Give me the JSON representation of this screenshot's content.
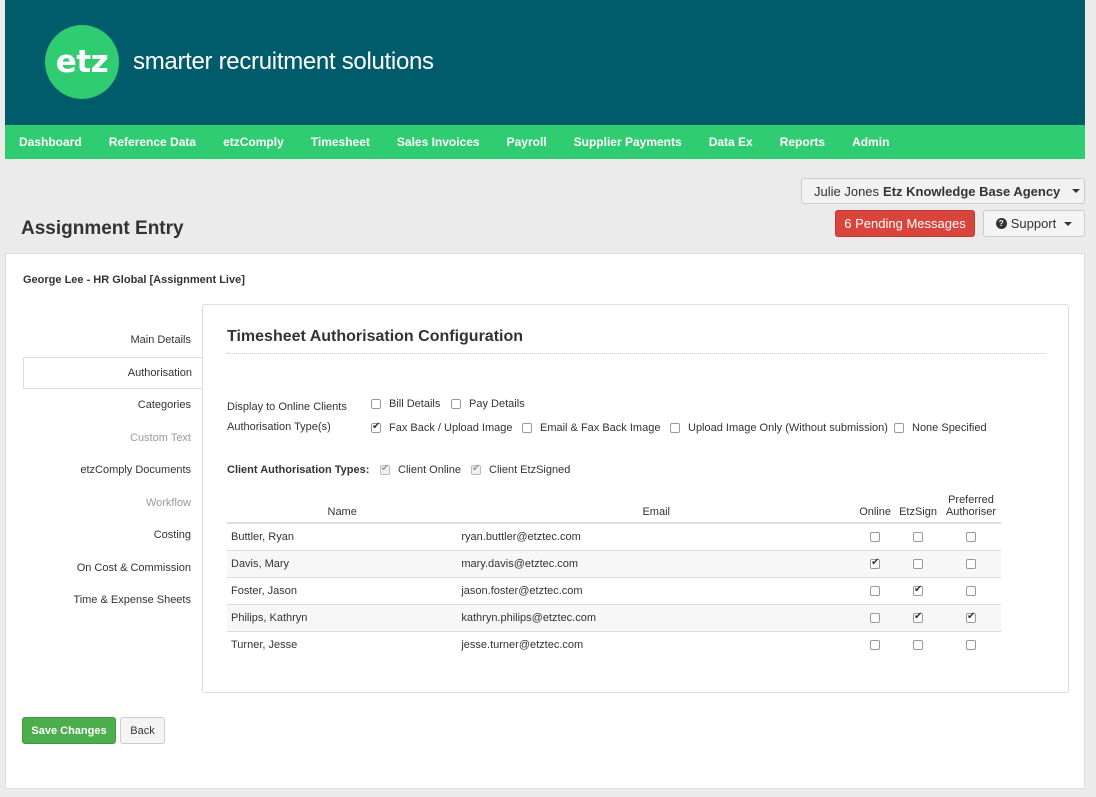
{
  "brand": {
    "logo_text": "etz",
    "tagline": "smarter recruitment solutions"
  },
  "nav": [
    "Dashboard",
    "Reference Data",
    "etzComply",
    "Timesheet",
    "Sales Invoices",
    "Payroll",
    "Supplier Payments",
    "Data Ex",
    "Reports",
    "Admin"
  ],
  "user": {
    "name": "Julie Jones",
    "agency": "Etz Knowledge Base Agency"
  },
  "pending_label": "6 Pending Messages",
  "support_label": "Support",
  "page_title": "Assignment Entry",
  "assignment_title": "George Lee - HR Global [Assignment Live]",
  "sidebar": [
    {
      "label": "Main Details",
      "state": "normal"
    },
    {
      "label": "Authorisation",
      "state": "active"
    },
    {
      "label": "Categories",
      "state": "normal"
    },
    {
      "label": "Custom Text",
      "state": "disabled"
    },
    {
      "label": "etzComply Documents",
      "state": "normal"
    },
    {
      "label": "Workflow",
      "state": "disabled"
    },
    {
      "label": "Costing",
      "state": "normal"
    },
    {
      "label": "On Cost & Commission",
      "state": "normal"
    },
    {
      "label": "Time & Expense Sheets",
      "state": "normal"
    }
  ],
  "section_title": "Timesheet Authorisation Configuration",
  "display_online": {
    "label": "Display to Online Clients",
    "options": [
      {
        "label": "Bill Details",
        "checked": false
      },
      {
        "label": "Pay Details",
        "checked": false
      }
    ]
  },
  "auth_types": {
    "label": "Authorisation Type(s)",
    "options": [
      {
        "label": "Fax Back / Upload Image",
        "checked": true
      },
      {
        "label": "Email & Fax Back Image",
        "checked": false
      },
      {
        "label": "Upload Image Only (Without submission)",
        "checked": false
      },
      {
        "label": "None Specified",
        "checked": false
      }
    ]
  },
  "client_auth": {
    "label": "Client Authorisation Types:",
    "options": [
      {
        "label": "Client Online",
        "checked": true
      },
      {
        "label": "Client EtzSigned",
        "checked": true
      }
    ]
  },
  "table": {
    "headers": {
      "name": "Name",
      "email": "Email",
      "online": "Online",
      "etzsign": "EtzSign",
      "preferred": "Preferred Authoriser"
    },
    "rows": [
      {
        "name": "Buttler, Ryan",
        "email": "ryan.buttler@etztec.com",
        "online": false,
        "etzsign": false,
        "preferred": false
      },
      {
        "name": "Davis, Mary",
        "email": "mary.davis@etztec.com",
        "online": true,
        "etzsign": false,
        "preferred": false
      },
      {
        "name": "Foster, Jason",
        "email": "jason.foster@etztec.com",
        "online": false,
        "etzsign": true,
        "preferred": false
      },
      {
        "name": "Philips, Kathryn",
        "email": "kathryn.philips@etztec.com",
        "online": false,
        "etzsign": true,
        "preferred": true
      },
      {
        "name": "Turner, Jesse",
        "email": "jesse.turner@etztec.com",
        "online": false,
        "etzsign": false,
        "preferred": false
      }
    ]
  },
  "buttons": {
    "save": "Save Changes",
    "back": "Back"
  },
  "colors": {
    "header": "#005c6b",
    "nav": "#2fcc71",
    "danger": "#d9453d",
    "success": "#4cae4c"
  }
}
